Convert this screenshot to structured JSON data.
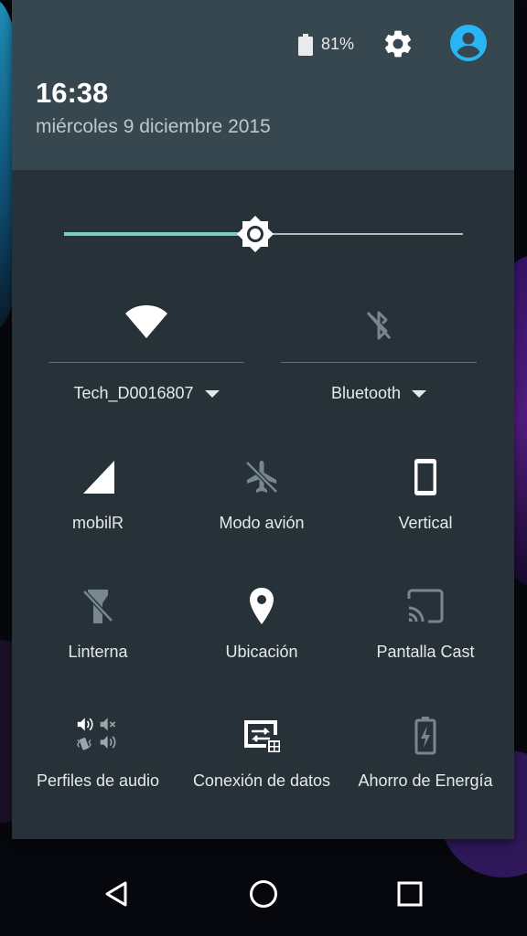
{
  "status": {
    "battery_percent": "81%",
    "battery_level": 0.81
  },
  "header": {
    "time": "16:38",
    "date": "miércoles 9 diciembre 2015"
  },
  "brightness": {
    "level": 0.48
  },
  "big_tiles": [
    {
      "label": "Tech_D0016807",
      "icon": "wifi-icon",
      "active": true
    },
    {
      "label": "Bluetooth",
      "icon": "bluetooth-disabled-icon",
      "active": false
    }
  ],
  "tiles": [
    {
      "label": "mobilR",
      "icon": "cell-signal-icon",
      "active": true
    },
    {
      "label": "Modo avión",
      "icon": "airplane-off-icon",
      "active": false
    },
    {
      "label": "Vertical",
      "icon": "portrait-icon",
      "active": true
    },
    {
      "label": "Linterna",
      "icon": "flashlight-off-icon",
      "active": false
    },
    {
      "label": "Ubicación",
      "icon": "location-pin-icon",
      "active": true
    },
    {
      "label": "Pantalla Cast",
      "icon": "cast-icon",
      "active": false
    },
    {
      "label": "Perfiles de audio",
      "icon": "audio-profiles-icon",
      "active": true
    },
    {
      "label": "Conexión de datos",
      "icon": "data-connection-icon",
      "active": true
    },
    {
      "label": "Ahorro de Energía",
      "icon": "battery-saver-icon",
      "active": false
    }
  ],
  "colors": {
    "shade": "#263238",
    "header": "#37474f",
    "accent": "#80cbc4",
    "avatar": "#29b6f6",
    "inactive_icon": "#78878d"
  }
}
